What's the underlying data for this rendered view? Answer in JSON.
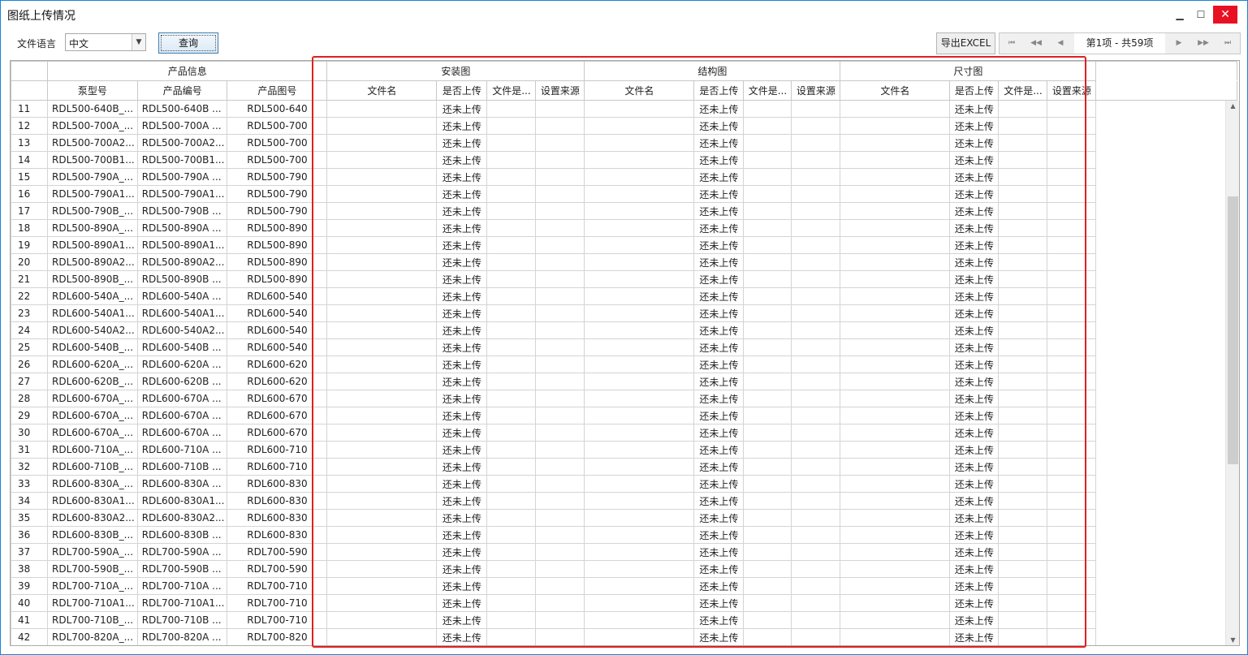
{
  "window": {
    "title": "图纸上传情况",
    "minimize_glyph": "▁",
    "maximize_glyph": "☐",
    "close_glyph": "✕"
  },
  "toolbar": {
    "language_label": "文件语言",
    "language_value": "中文",
    "query_label": "查询",
    "export_label": "导出EXCEL",
    "pager_info": "第1项 - 共59项"
  },
  "grid": {
    "groups": [
      "产品信息",
      "安装图",
      "结构图",
      "尺寸图"
    ],
    "product_columns": [
      "泵型号",
      "产品编号",
      "产品图号"
    ],
    "drawing_columns": [
      "文件名",
      "是否上传",
      "文件是...",
      "设置来源"
    ],
    "status_text": "还未上传",
    "rows": [
      {
        "no": "11",
        "model": "RDL500-640B_...",
        "code": "RDL500-640B ...",
        "drawing": "RDL500-640"
      },
      {
        "no": "12",
        "model": "RDL500-700A_...",
        "code": "RDL500-700A ...",
        "drawing": "RDL500-700"
      },
      {
        "no": "13",
        "model": "RDL500-700A2...",
        "code": "RDL500-700A2...",
        "drawing": "RDL500-700"
      },
      {
        "no": "14",
        "model": "RDL500-700B1...",
        "code": "RDL500-700B1...",
        "drawing": "RDL500-700"
      },
      {
        "no": "15",
        "model": "RDL500-790A_...",
        "code": "RDL500-790A ...",
        "drawing": "RDL500-790"
      },
      {
        "no": "16",
        "model": "RDL500-790A1...",
        "code": "RDL500-790A1...",
        "drawing": "RDL500-790"
      },
      {
        "no": "17",
        "model": "RDL500-790B_...",
        "code": "RDL500-790B ...",
        "drawing": "RDL500-790"
      },
      {
        "no": "18",
        "model": "RDL500-890A_...",
        "code": "RDL500-890A ...",
        "drawing": "RDL500-890"
      },
      {
        "no": "19",
        "model": "RDL500-890A1...",
        "code": "RDL500-890A1...",
        "drawing": "RDL500-890"
      },
      {
        "no": "20",
        "model": "RDL500-890A2...",
        "code": "RDL500-890A2...",
        "drawing": "RDL500-890"
      },
      {
        "no": "21",
        "model": "RDL500-890B_...",
        "code": "RDL500-890B ...",
        "drawing": "RDL500-890"
      },
      {
        "no": "22",
        "model": "RDL600-540A_...",
        "code": "RDL600-540A ...",
        "drawing": "RDL600-540"
      },
      {
        "no": "23",
        "model": "RDL600-540A1...",
        "code": "RDL600-540A1...",
        "drawing": "RDL600-540"
      },
      {
        "no": "24",
        "model": "RDL600-540A2...",
        "code": "RDL600-540A2...",
        "drawing": "RDL600-540"
      },
      {
        "no": "25",
        "model": "RDL600-540B_...",
        "code": "RDL600-540B ...",
        "drawing": "RDL600-540"
      },
      {
        "no": "26",
        "model": "RDL600-620A_...",
        "code": "RDL600-620A ...",
        "drawing": "RDL600-620"
      },
      {
        "no": "27",
        "model": "RDL600-620B_...",
        "code": "RDL600-620B ...",
        "drawing": "RDL600-620"
      },
      {
        "no": "28",
        "model": "RDL600-670A_...",
        "code": "RDL600-670A ...",
        "drawing": "RDL600-670"
      },
      {
        "no": "29",
        "model": "RDL600-670A_...",
        "code": "RDL600-670A ...",
        "drawing": "RDL600-670"
      },
      {
        "no": "30",
        "model": "RDL600-670A_...",
        "code": "RDL600-670A ...",
        "drawing": "RDL600-670"
      },
      {
        "no": "31",
        "model": "RDL600-710A_...",
        "code": "RDL600-710A ...",
        "drawing": "RDL600-710"
      },
      {
        "no": "32",
        "model": "RDL600-710B_...",
        "code": "RDL600-710B ...",
        "drawing": "RDL600-710"
      },
      {
        "no": "33",
        "model": "RDL600-830A_...",
        "code": "RDL600-830A ...",
        "drawing": "RDL600-830"
      },
      {
        "no": "34",
        "model": "RDL600-830A1...",
        "code": "RDL600-830A1...",
        "drawing": "RDL600-830"
      },
      {
        "no": "35",
        "model": "RDL600-830A2...",
        "code": "RDL600-830A2...",
        "drawing": "RDL600-830"
      },
      {
        "no": "36",
        "model": "RDL600-830B_...",
        "code": "RDL600-830B ...",
        "drawing": "RDL600-830"
      },
      {
        "no": "37",
        "model": "RDL700-590A_...",
        "code": "RDL700-590A ...",
        "drawing": "RDL700-590"
      },
      {
        "no": "38",
        "model": "RDL700-590B_...",
        "code": "RDL700-590B ...",
        "drawing": "RDL700-590"
      },
      {
        "no": "39",
        "model": "RDL700-710A_...",
        "code": "RDL700-710A ...",
        "drawing": "RDL700-710"
      },
      {
        "no": "40",
        "model": "RDL700-710A1...",
        "code": "RDL700-710A1...",
        "drawing": "RDL700-710"
      },
      {
        "no": "41",
        "model": "RDL700-710B_...",
        "code": "RDL700-710B ...",
        "drawing": "RDL700-710"
      },
      {
        "no": "42",
        "model": "RDL700-820A_...",
        "code": "RDL700-820A ...",
        "drawing": "RDL700-820"
      }
    ]
  },
  "icons": {
    "dropdown": "chevron-down-icon",
    "first": "first-page-icon",
    "prev_fast": "fast-back-icon",
    "prev": "prev-icon",
    "next": "next-icon",
    "next_fast": "fast-forward-icon",
    "last": "last-page-icon"
  },
  "colors": {
    "highlight": "#e02020",
    "close_button": "#e81123",
    "window_border": "#1883d7"
  }
}
